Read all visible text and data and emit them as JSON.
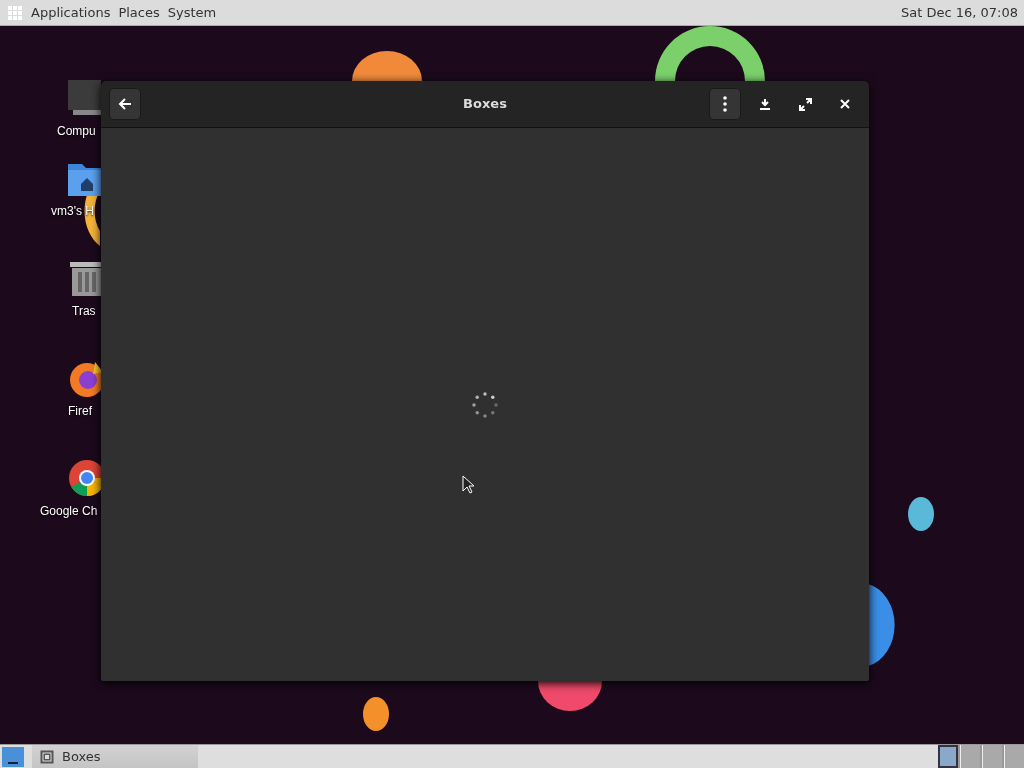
{
  "top_panel": {
    "menus": [
      "Applications",
      "Places",
      "System"
    ],
    "clock": "Sat Dec 16, 07:08"
  },
  "desktop_icons": [
    {
      "kind": "computer",
      "label": "Compu"
    },
    {
      "kind": "home",
      "label": "vm3's H"
    },
    {
      "kind": "trash",
      "label": "Tras"
    },
    {
      "kind": "firefox",
      "label": "Firef"
    },
    {
      "kind": "chrome",
      "label": "Google Ch"
    }
  ],
  "window": {
    "title": "Boxes",
    "loading": true
  },
  "taskbar": {
    "tasks": [
      {
        "label": "Boxes"
      }
    ],
    "workspaces": [
      {
        "selected": true
      },
      {
        "selected": false
      },
      {
        "selected": false
      },
      {
        "selected": false
      }
    ]
  }
}
